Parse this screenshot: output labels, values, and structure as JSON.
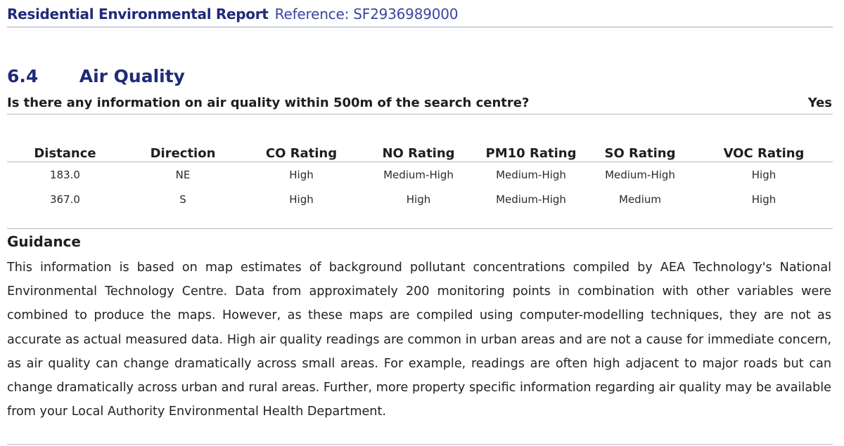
{
  "header": {
    "title": "Residential Environmental Report",
    "reference": "Reference: SF2936989000"
  },
  "section": {
    "number": "6.4",
    "title": "Air Quality"
  },
  "question": {
    "text": "Is there any information on air quality within 500m of the search centre?",
    "answer": "Yes"
  },
  "table": {
    "columns": [
      "Distance",
      "Direction",
      "CO Rating",
      "NO Rating",
      "PM10 Rating",
      "SO Rating",
      "VOC Rating"
    ],
    "rows": [
      [
        "183.0",
        "NE",
        "High",
        "Medium-High",
        "Medium-High",
        "Medium-High",
        "High"
      ],
      [
        "367.0",
        "S",
        "High",
        "High",
        "Medium-High",
        "Medium",
        "High"
      ]
    ]
  },
  "guidance": {
    "heading": "Guidance",
    "body": "This information is based on map estimates of background pollutant concentrations compiled by AEA Technology's National Environmental Technology Centre. Data from approximately 200 monitoring points in combination with other variables were combined to produce the maps. However, as these maps are compiled using computer-modelling techniques, they are not as accurate as actual measured data. High air quality readings are common in urban areas and are not a cause for immediate concern, as air quality can change dramatically across small areas. For example, readings are often high adjacent to major roads but can change dramatically across urban and rural areas. Further, more property specific information regarding air quality may be available from your Local Authority Environmental Health Department."
  },
  "colors": {
    "heading_blue": "#1f2a78",
    "reference_blue": "#3a46a0",
    "rule_gray": "#b9b9b9"
  }
}
